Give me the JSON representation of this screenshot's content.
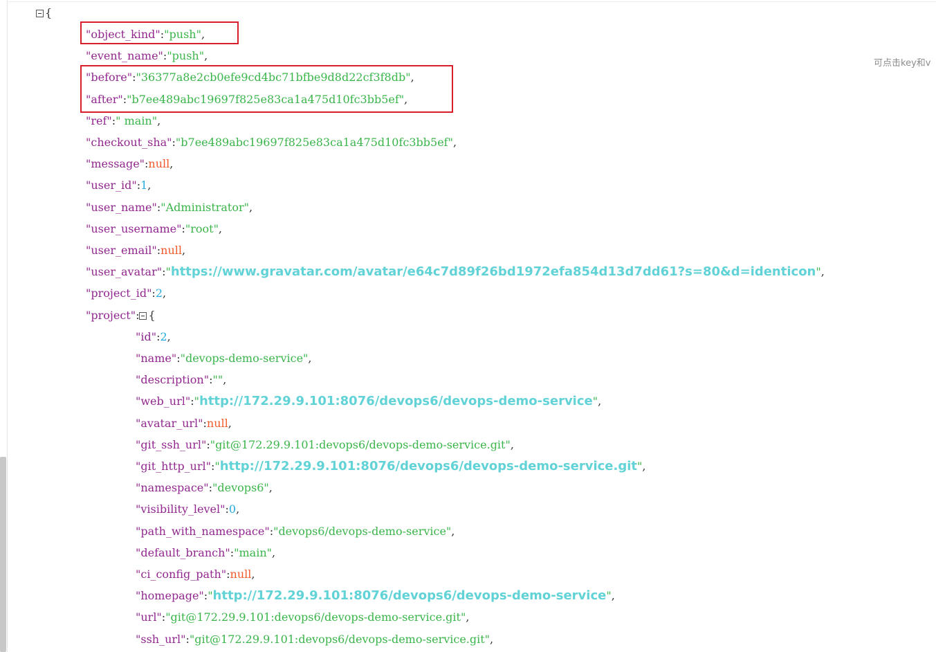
{
  "hint_text": "可点击key和v",
  "json_view": {
    "root_open": "{",
    "top_fields": [
      {
        "key": "\"object_kind\"",
        "type": "str",
        "value": "\"push\""
      },
      {
        "key": "\"event_name\"",
        "type": "str",
        "value": "\"push\""
      },
      {
        "key": "\"before\"",
        "type": "str",
        "value": "\"36377a8e2cb0efe9cd4bc71bfbe9d8d22cf3f8db\""
      },
      {
        "key": "\"after\"",
        "type": "str",
        "value": "\"b7ee489abc19697f825e83ca1a475d10fc3bb5ef\""
      },
      {
        "key": "\"ref\"",
        "type": "str",
        "value": "\" main\""
      },
      {
        "key": "\"checkout_sha\"",
        "type": "str",
        "value": "\"b7ee489abc19697f825e83ca1a475d10fc3bb5ef\""
      },
      {
        "key": "\"message\"",
        "type": "null",
        "value": "null"
      },
      {
        "key": "\"user_id\"",
        "type": "num",
        "value": "1"
      },
      {
        "key": "\"user_name\"",
        "type": "str",
        "value": "\"Administrator\""
      },
      {
        "key": "\"user_username\"",
        "type": "str",
        "value": "\"root\""
      },
      {
        "key": "\"user_email\"",
        "type": "null",
        "value": "null"
      },
      {
        "key": "\"user_avatar\"",
        "type": "link",
        "value": "https://www.gravatar.com/avatar/e64c7d89f26bd1972efa854d13d7dd61?s=80&d=identicon"
      },
      {
        "key": "\"project_id\"",
        "type": "num",
        "value": "2"
      }
    ],
    "project_key": "\"project\"",
    "project_open": "{",
    "project_fields": [
      {
        "key": "\"id\"",
        "type": "num",
        "value": "2"
      },
      {
        "key": "\"name\"",
        "type": "str",
        "value": "\"devops-demo-service\""
      },
      {
        "key": "\"description\"",
        "type": "str",
        "value": "\"\""
      },
      {
        "key": "\"web_url\"",
        "type": "link",
        "value": "http://172.29.9.101:8076/devops6/devops-demo-service"
      },
      {
        "key": "\"avatar_url\"",
        "type": "null",
        "value": "null"
      },
      {
        "key": "\"git_ssh_url\"",
        "type": "str",
        "value": "\"git@172.29.9.101:devops6/devops-demo-service.git\""
      },
      {
        "key": "\"git_http_url\"",
        "type": "link",
        "value": "http://172.29.9.101:8076/devops6/devops-demo-service.git"
      },
      {
        "key": "\"namespace\"",
        "type": "str",
        "value": "\"devops6\""
      },
      {
        "key": "\"visibility_level\"",
        "type": "num",
        "value": "0"
      },
      {
        "key": "\"path_with_namespace\"",
        "type": "str",
        "value": "\"devops6/devops-demo-service\""
      },
      {
        "key": "\"default_branch\"",
        "type": "str",
        "value": "\"main\""
      },
      {
        "key": "\"ci_config_path\"",
        "type": "null",
        "value": "null"
      },
      {
        "key": "\"homepage\"",
        "type": "link",
        "value": "http://172.29.9.101:8076/devops6/devops-demo-service"
      },
      {
        "key": "\"url\"",
        "type": "str",
        "value": "\"git@172.29.9.101:devops6/devops-demo-service.git\""
      },
      {
        "key": "\"ssh_url\"",
        "type": "str",
        "value": "\"git@172.29.9.101:devops6/devops-demo-service.git\""
      }
    ]
  },
  "colors": {
    "key": "#92278f",
    "string": "#3ab54a",
    "number": "#25aae2",
    "null": "#f1592a",
    "link": "#61d2d6",
    "highlight_box": "#d81e2b"
  }
}
